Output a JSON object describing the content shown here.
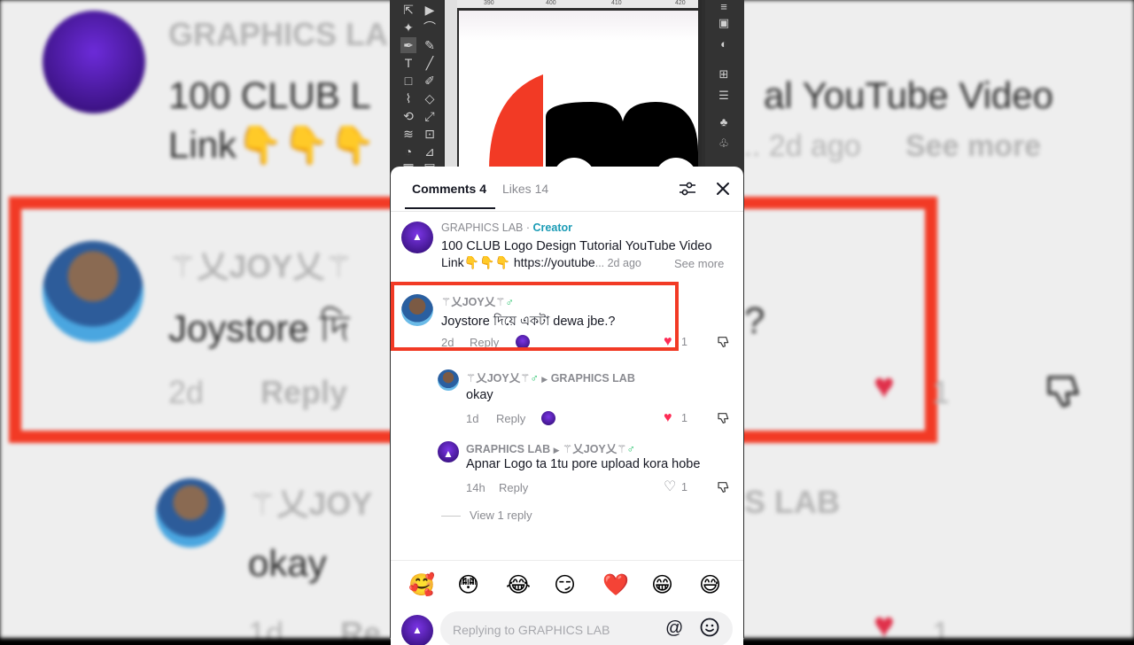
{
  "background": {
    "top_name": "GRAPHICS LA",
    "top_text_left": "100 CLUB L",
    "top_text_right": "al YouTube Video",
    "top_line2_left": "Link",
    "top_emojis": "👇👇👇",
    "top_meta_right": "... 2d ago",
    "top_see_more": "See more",
    "hl_name": "⚚乂JOY乂⚚",
    "hl_text": "Joystore দি",
    "hl_q": "?",
    "hl_time": "2d",
    "hl_reply": "Reply",
    "hl_like_count": "1",
    "bottom_name": "⚚乂JOY",
    "bottom_name_right": "S LAB",
    "bottom_text": "okay",
    "bottom_time": "1d",
    "bottom_reply": "Re",
    "bottom_like_count": "1"
  },
  "editor": {
    "ruler_marks": [
      "390",
      "400",
      "410",
      "420"
    ]
  },
  "sheet": {
    "tabs": {
      "comments": "Comments 4",
      "likes": "Likes 14"
    },
    "caption": {
      "author": "GRAPHICS LAB",
      "separator": "·",
      "badge": "Creator",
      "line1": "100 CLUB Logo Design Tutorial YouTube Video",
      "line2_prefix": "Link",
      "line2_emojis": "👇👇👇",
      "line2_link": "https://youtube",
      "line2_meta": "... 2d ago",
      "see_more": "See more"
    },
    "comments": [
      {
        "author": "⚚乂JOY乂⚚",
        "gender": "♂",
        "text": "Joystore দিয়ে একটা dewa jbe.?",
        "time": "2d",
        "reply": "Reply",
        "likes": "1",
        "liked": true
      },
      {
        "author": "⚚乂JOY乂⚚",
        "gender": "♂",
        "reply_to": "GRAPHICS LAB",
        "text": "okay",
        "time": "1d",
        "reply": "Reply",
        "likes": "1",
        "liked": true
      },
      {
        "author": "GRAPHICS LAB",
        "reply_to": "⚚乂JOY乂⚚",
        "reply_to_gender": "♂",
        "text": "Apnar Logo ta 1tu pore upload kora hobe",
        "time": "14h",
        "reply": "Reply",
        "likes": "1",
        "liked": false
      }
    ],
    "view_replies": "View 1 reply",
    "emojis": [
      "🥰",
      "😳",
      "😂",
      "😏",
      "❤️",
      "😁",
      "😅"
    ],
    "input_placeholder": "Replying to GRAPHICS LAB",
    "colors": {
      "highlight_border": "#f23a25",
      "like_red": "#fe2c55",
      "creator_teal": "#1a9bb5"
    }
  }
}
